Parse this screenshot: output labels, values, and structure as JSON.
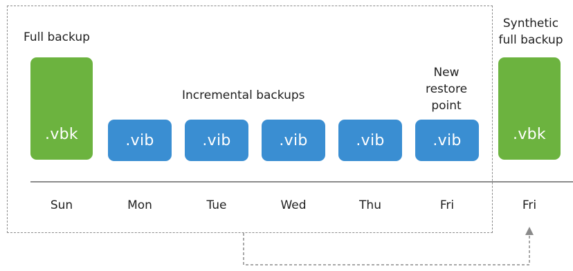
{
  "labels": {
    "full_backup": "Full backup",
    "incremental_backups": "Incremental backups",
    "new_restore_point_1": "New",
    "new_restore_point_2": "restore",
    "new_restore_point_3": "point",
    "synthetic_1": "Synthetic",
    "synthetic_2": "full backup"
  },
  "blocks": [
    {
      "text": ".vbk",
      "kind": "full"
    },
    {
      "text": ".vib",
      "kind": "incremental"
    },
    {
      "text": ".vib",
      "kind": "incremental"
    },
    {
      "text": ".vib",
      "kind": "incremental"
    },
    {
      "text": ".vib",
      "kind": "incremental"
    },
    {
      "text": ".vib",
      "kind": "incremental"
    },
    {
      "text": ".vbk",
      "kind": "synthetic"
    }
  ],
  "days": [
    "Sun",
    "Mon",
    "Tue",
    "Wed",
    "Thu",
    "Fri",
    "Fri"
  ],
  "colors": {
    "full_backup": "#6cb33f",
    "incremental_backup": "#3a8ed2",
    "dashed_border": "#8a8a8a"
  }
}
